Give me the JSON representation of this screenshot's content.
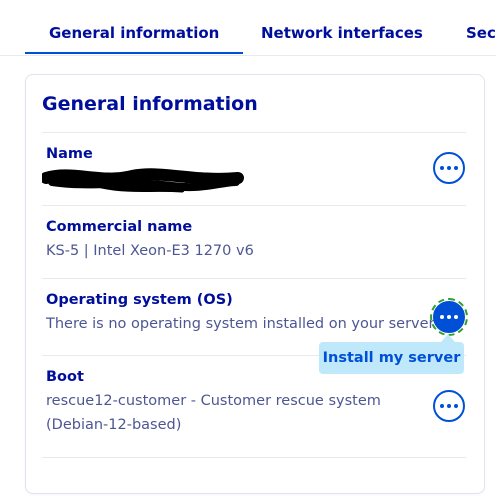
{
  "tabs": [
    {
      "label": "General information",
      "active": true
    },
    {
      "label": "Network interfaces",
      "active": false
    },
    {
      "label": "Secc",
      "active": false
    }
  ],
  "card": {
    "title": "General information",
    "rows": [
      {
        "label": "Name",
        "value": "",
        "redacted": true,
        "action_icon": "more-dots-icon"
      },
      {
        "label": "Commercial name",
        "value": "KS-5 | Intel Xeon-E3 1270 v6"
      },
      {
        "label": "Operating system (OS)",
        "value": "There is no operating system installed on your server",
        "action_icon": "more-dots-icon",
        "action_active": true
      },
      {
        "label": "Boot",
        "value_line1": "rescue12-customer - Customer rescue system",
        "value_line2": "(Debian-12-based)",
        "action_icon": "more-dots-icon"
      }
    ]
  },
  "tooltip": {
    "label": "Install my server"
  },
  "colors": {
    "accent": "#0050d7",
    "text": "#000e9c",
    "muted": "#4d5693",
    "tooltip_bg": "#bfe8fb",
    "focus": "#2f9e2f"
  }
}
